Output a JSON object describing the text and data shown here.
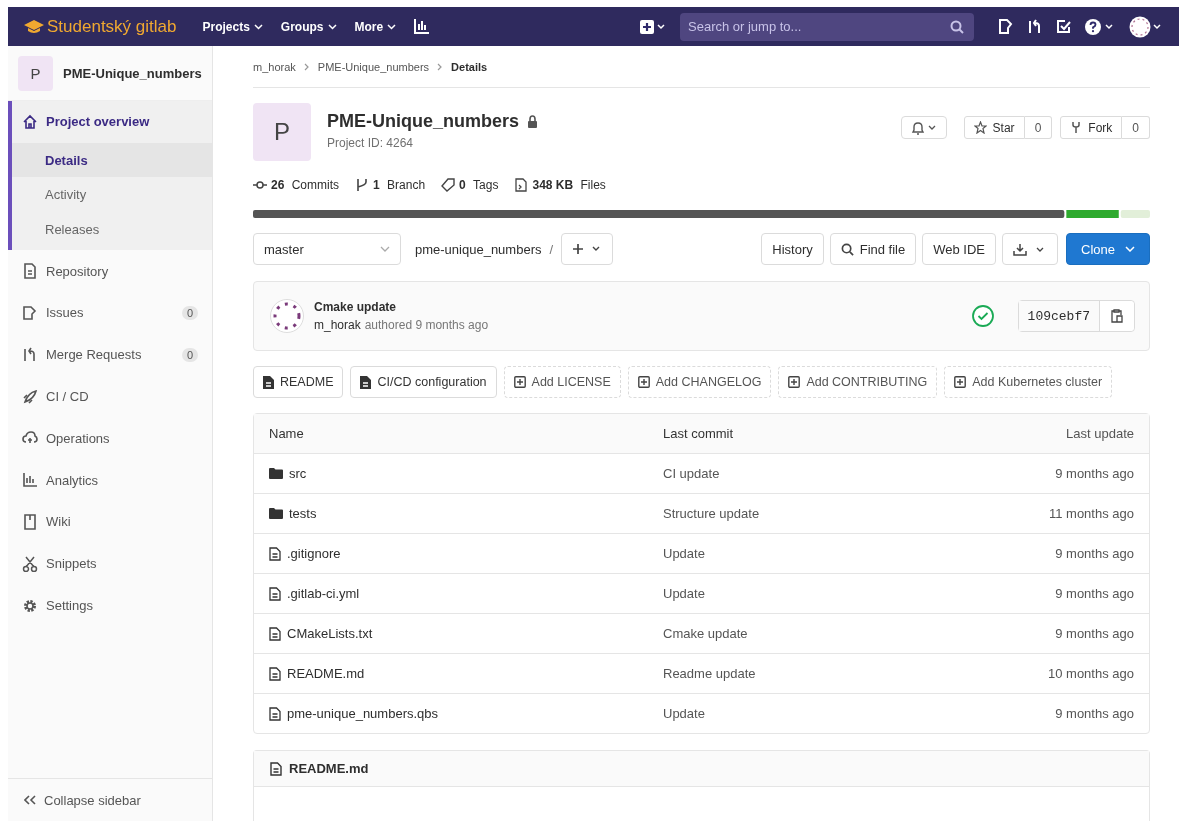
{
  "navbar": {
    "brand": "Studentský gitlab",
    "menus": [
      {
        "label": "Projects"
      },
      {
        "label": "Groups"
      },
      {
        "label": "More"
      }
    ],
    "search": {
      "placeholder": "Search or jump to..."
    }
  },
  "sidebar": {
    "project": {
      "avatar": "P",
      "name": "PME-Unique_numbers"
    },
    "items": [
      {
        "label": "Project overview",
        "selected": true,
        "expanded": true,
        "children": [
          {
            "label": "Details",
            "selected": true
          },
          {
            "label": "Activity",
            "selected": false
          },
          {
            "label": "Releases",
            "selected": false
          }
        ]
      },
      {
        "label": "Repository",
        "selected": false
      },
      {
        "label": "Issues",
        "selected": false,
        "count": "0"
      },
      {
        "label": "Merge Requests",
        "selected": false,
        "count": "0"
      },
      {
        "label": "CI / CD",
        "selected": false
      },
      {
        "label": "Operations",
        "selected": false
      },
      {
        "label": "Analytics",
        "selected": false
      },
      {
        "label": "Wiki",
        "selected": false
      },
      {
        "label": "Snippets",
        "selected": false
      },
      {
        "label": "Settings",
        "selected": false
      }
    ],
    "collapse": "Collapse sidebar"
  },
  "breadcrumbs": [
    "m_horak",
    "PME-Unique_numbers",
    "Details"
  ],
  "project": {
    "avatar": "P",
    "name": "PME-Unique_numbers",
    "id": "Project ID: 4264",
    "star": {
      "label": "Star",
      "count": "0"
    },
    "fork": {
      "label": "Fork",
      "count": "0"
    }
  },
  "stats": [
    {
      "value": "26",
      "label": "Commits"
    },
    {
      "value": "1",
      "label": "Branch"
    },
    {
      "value": "0",
      "label": "Tags"
    },
    {
      "value": "348 KB",
      "label": "Files"
    }
  ],
  "toolbar": {
    "branch": "master",
    "path": "pme-unique_numbers",
    "separator": "/",
    "buttons": [
      "History",
      "Find file",
      "Web IDE"
    ],
    "clone": "Clone"
  },
  "commit": {
    "title": "Cmake update",
    "author": "m_horak",
    "meta": "authored 9 months ago",
    "pipeline_passed": true,
    "sha": "109cebf7"
  },
  "quick_buttons": [
    {
      "label": "README",
      "kind": "existing"
    },
    {
      "label": "CI/CD configuration",
      "kind": "existing"
    },
    {
      "label": "Add LICENSE",
      "kind": "add"
    },
    {
      "label": "Add CHANGELOG",
      "kind": "add"
    },
    {
      "label": "Add CONTRIBUTING",
      "kind": "add"
    },
    {
      "label": "Add Kubernetes cluster",
      "kind": "add"
    }
  ],
  "table": {
    "columns": [
      "Name",
      "Last commit",
      "Last update"
    ],
    "rows": [
      {
        "kind": "folder",
        "name": "src",
        "commit": "CI update",
        "updated": "9 months ago"
      },
      {
        "kind": "folder",
        "name": "tests",
        "commit": "Structure update",
        "updated": "11 months ago"
      },
      {
        "kind": "file",
        "name": ".gitignore",
        "commit": "Update",
        "updated": "9 months ago"
      },
      {
        "kind": "file",
        "name": ".gitlab-ci.yml",
        "commit": "Update",
        "updated": "9 months ago"
      },
      {
        "kind": "file",
        "name": "CMakeLists.txt",
        "commit": "Cmake update",
        "updated": "9 months ago"
      },
      {
        "kind": "file",
        "name": "README.md",
        "commit": "Readme update",
        "updated": "10 months ago"
      },
      {
        "kind": "file",
        "name": "pme-unique_numbers.qbs",
        "commit": "Update",
        "updated": "9 months ago"
      }
    ]
  },
  "readme": {
    "title": "README.md"
  }
}
